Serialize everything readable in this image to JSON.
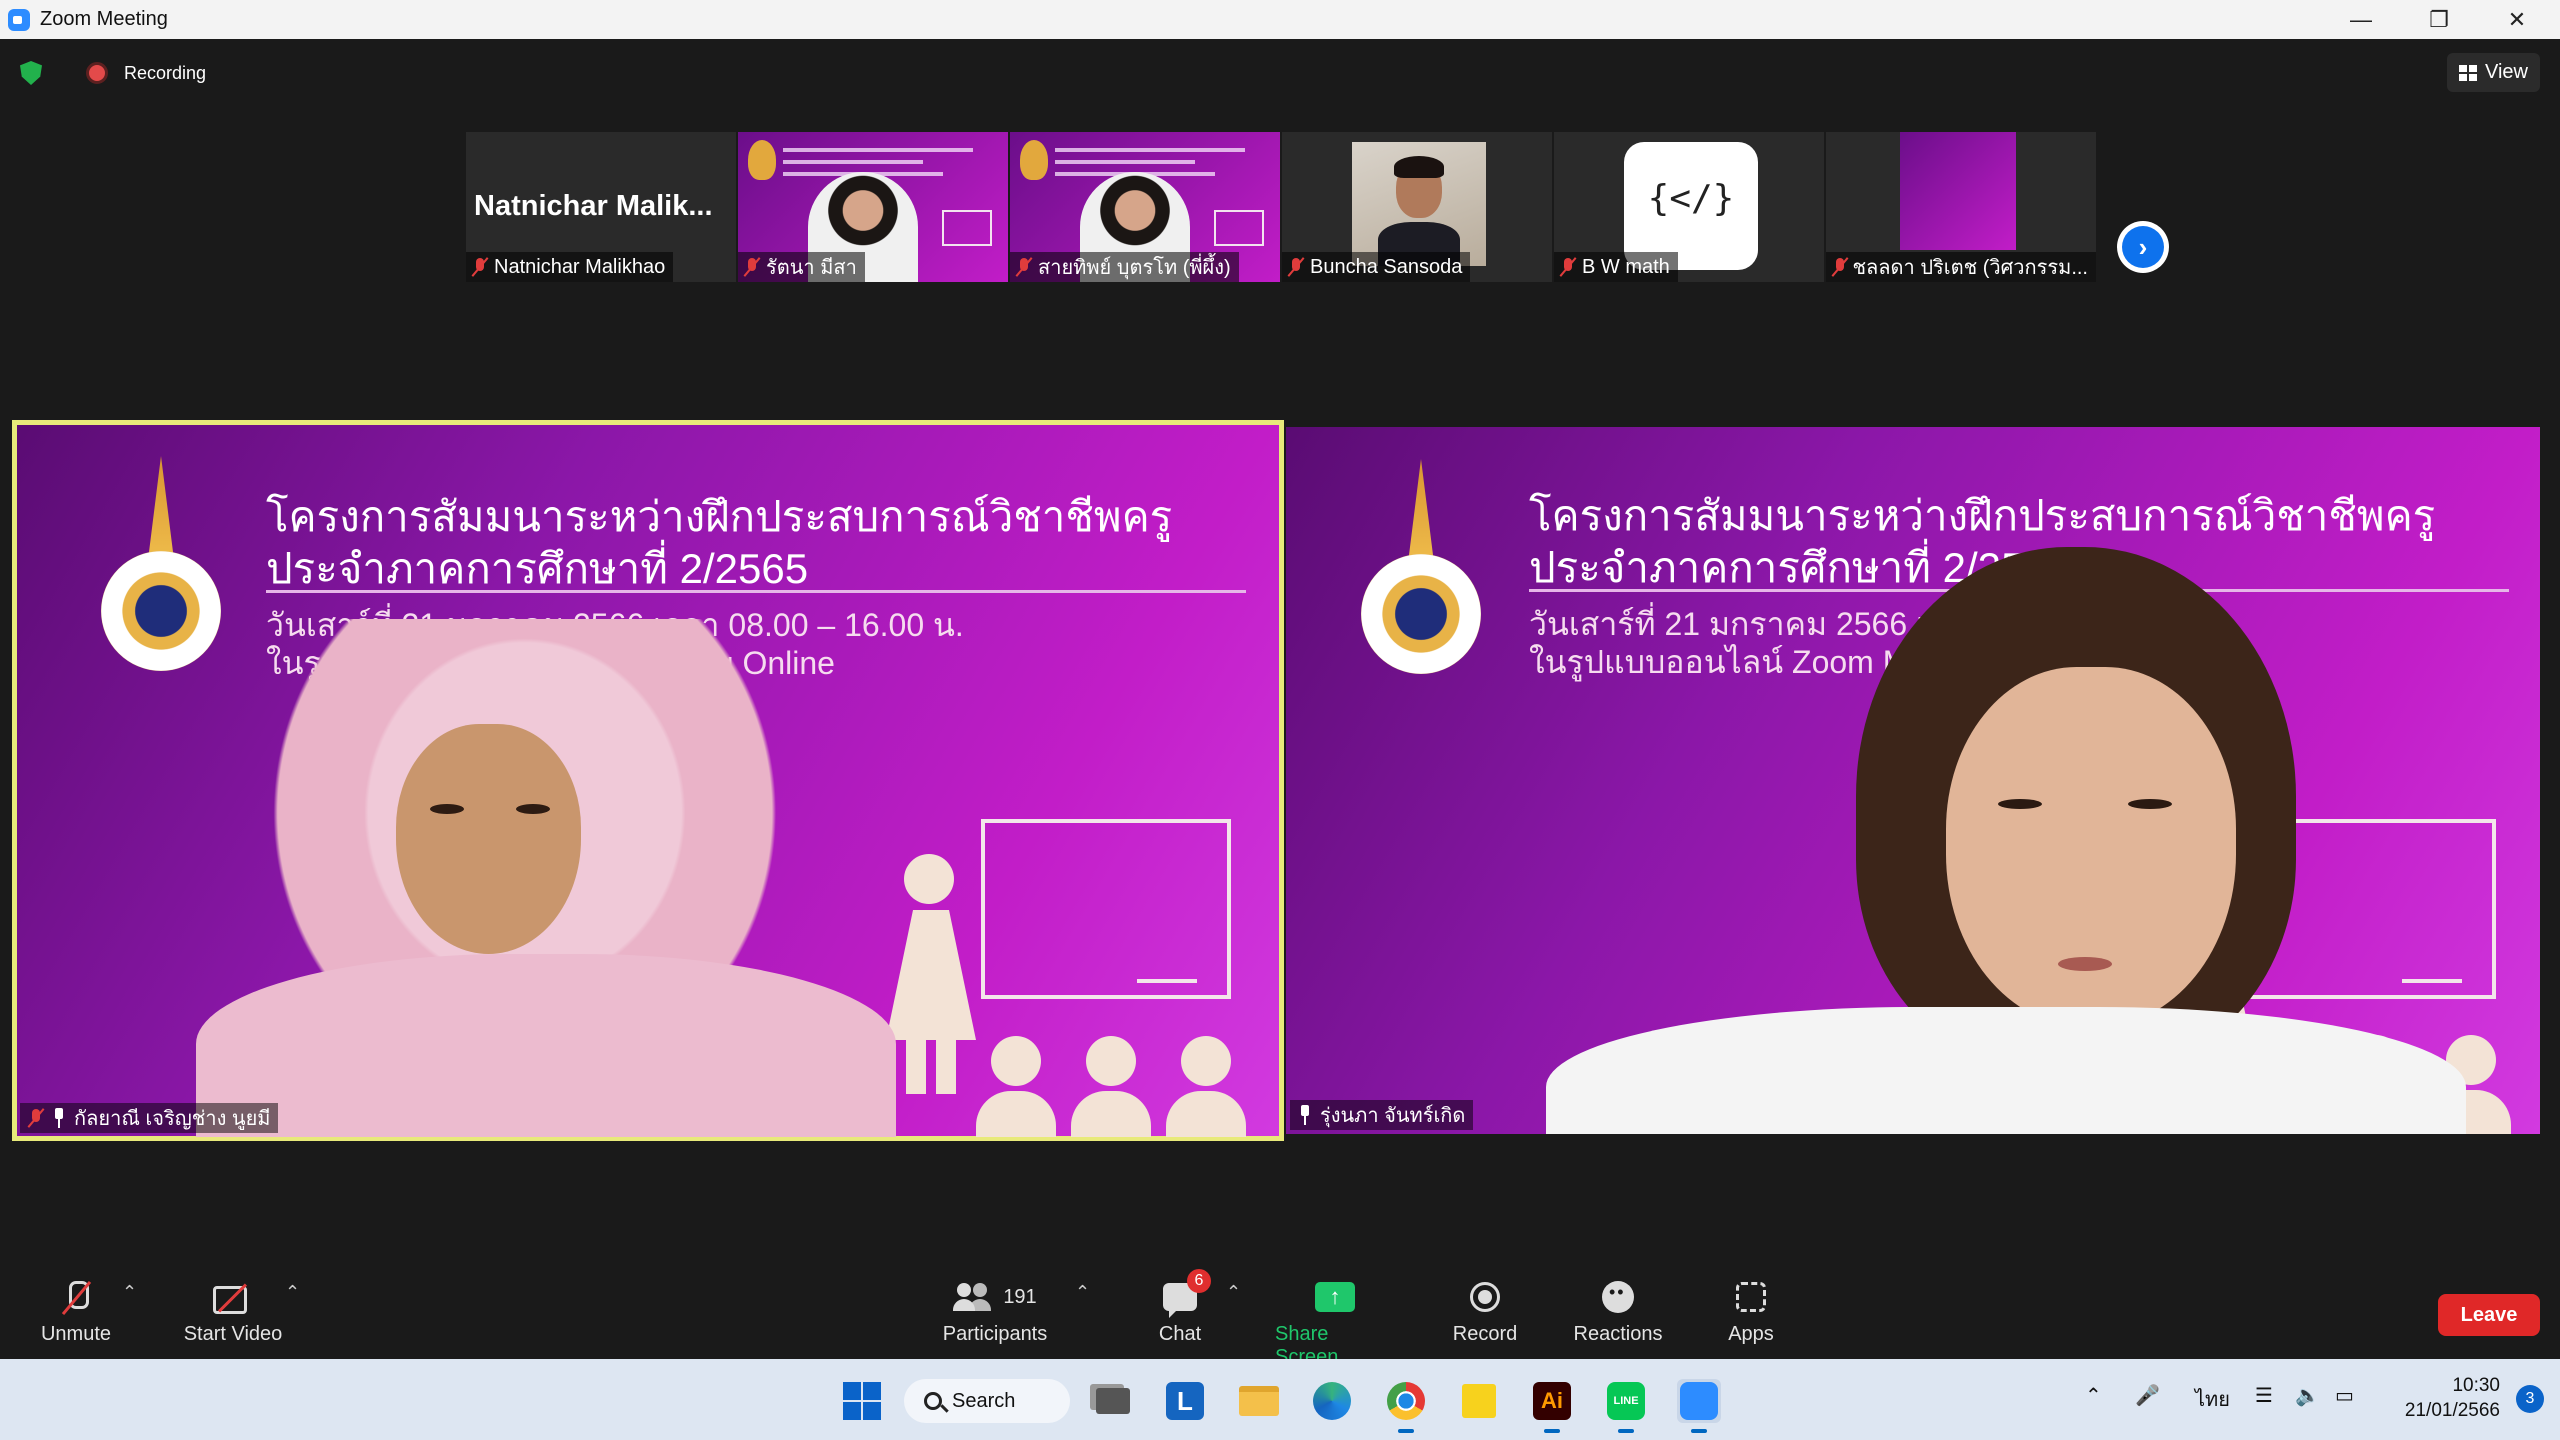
{
  "window": {
    "title": "Zoom Meeting"
  },
  "topbar": {
    "recording": "Recording",
    "view": "View"
  },
  "thumbnails": [
    {
      "big_name": "Natnichar  Malik...",
      "label": "Natnichar Malikhao"
    },
    {
      "label": "รัตนา มีสา"
    },
    {
      "label": "สายทิพย์ บุตรโท (พี่ผึ้ง)"
    },
    {
      "label": "Buncha Sansoda"
    },
    {
      "label": "B W math",
      "logo_text": "{</}"
    },
    {
      "label": "ชลลดา ปริเตช (วิศวกรรม..."
    }
  ],
  "slide": {
    "title_line1": "โครงการสัมมนาระหว่างฝึกประสบการณ์วิชาชีพครู",
    "title_line2": "ประจำภาคการศึกษาที่ 2/2565",
    "sub_line1": "วันเสาร์ที่ 21 มกราคม 2566 เวลา 08.00 – 16.00 น.",
    "sub_line2": "ในรูปแบบออนไลน์ Zoom Meeting Online"
  },
  "videos": {
    "left_label": "กัลยาณี เจริญช่าง นูยมี",
    "right_label": "รุ่งนภา จันทร์เกิด"
  },
  "toolbar": {
    "unmute": "Unmute",
    "start_video": "Start Video",
    "participants_count": "191",
    "participants": "Participants",
    "chat": "Chat",
    "chat_badge": "6",
    "share": "Share Screen",
    "record": "Record",
    "reactions": "Reactions",
    "apps": "Apps",
    "leave": "Leave"
  },
  "taskbar": {
    "search": "Search",
    "language": "ไทย",
    "time": "10:30",
    "date": "21/01/2566",
    "notifications": "3"
  },
  "colors": {
    "accent": "#0e72ed",
    "share_green": "#1fc76b",
    "leave_red": "#e02828",
    "active_outline": "#e8ea7a"
  }
}
